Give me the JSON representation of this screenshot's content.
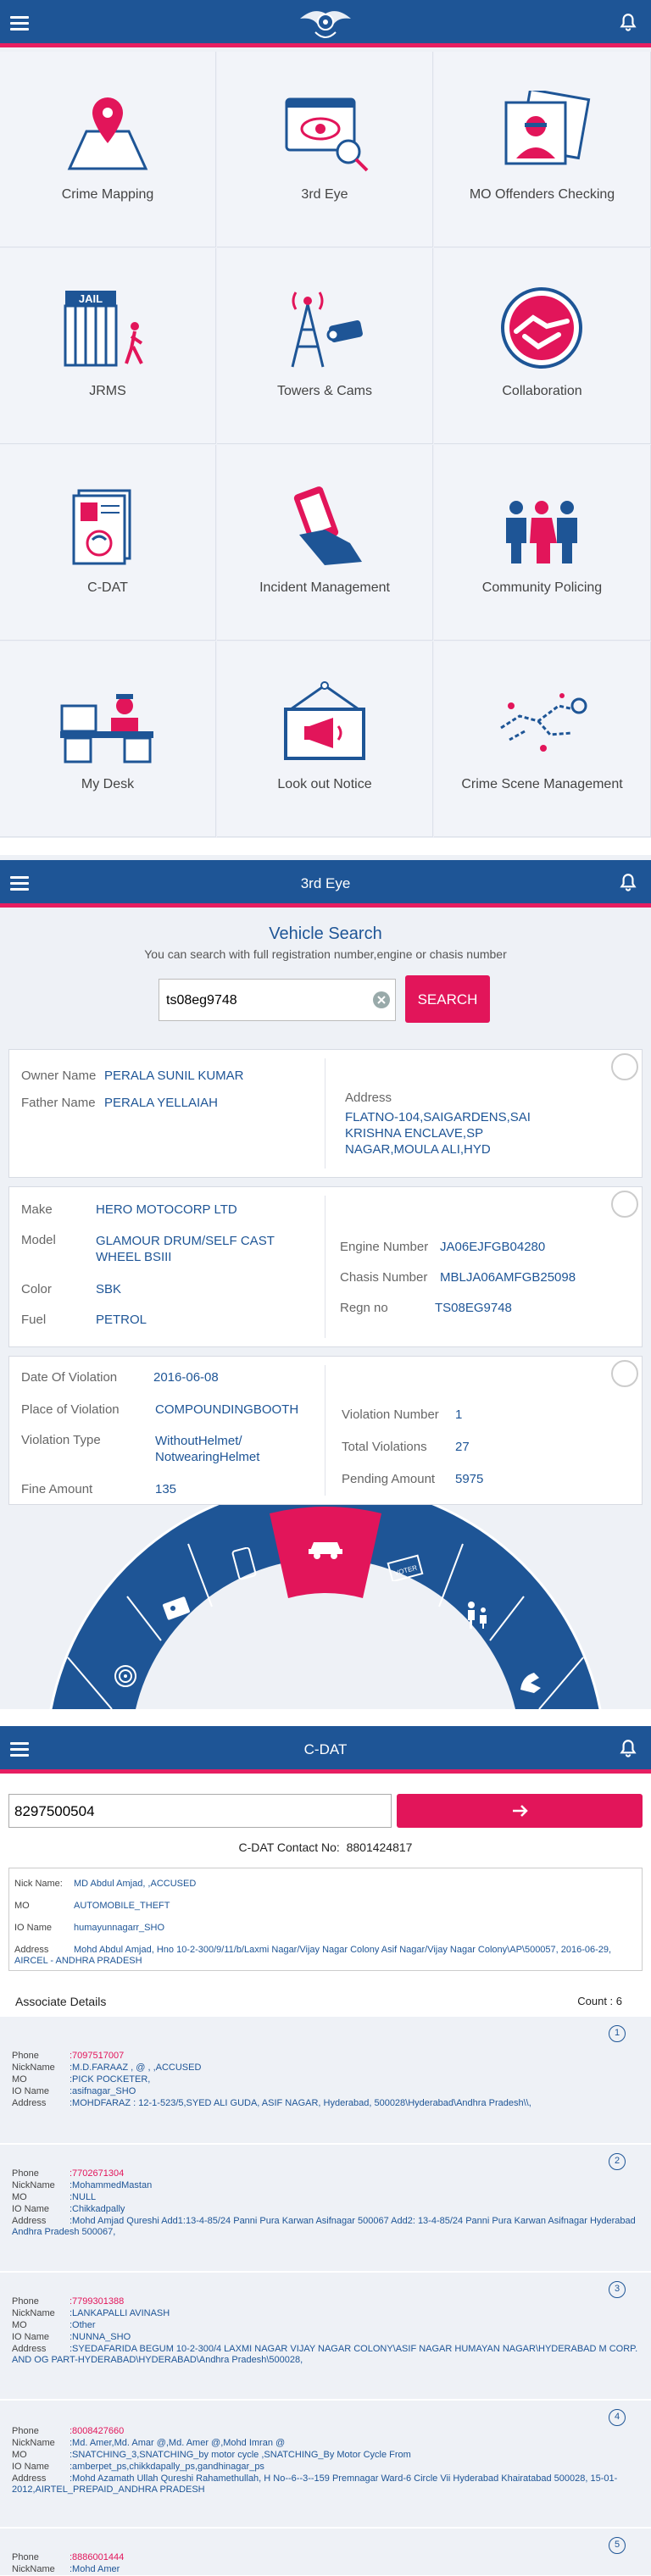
{
  "home": {
    "tiles": [
      {
        "label": "Crime Mapping",
        "icon": "map-pin-icon"
      },
      {
        "label": "3rd Eye",
        "icon": "eye-monitor-icon"
      },
      {
        "label": "MO Offenders Checking",
        "icon": "offender-photo-icon"
      },
      {
        "label": "JRMS",
        "icon": "jail-icon"
      },
      {
        "label": "Towers & Cams",
        "icon": "tower-camera-icon"
      },
      {
        "label": "Collaboration",
        "icon": "handshake-icon"
      },
      {
        "label": "C-DAT",
        "icon": "phone-document-icon"
      },
      {
        "label": "Incident Management",
        "icon": "hand-phone-icon"
      },
      {
        "label": "Community Policing",
        "icon": "people-icon"
      },
      {
        "label": "My Desk",
        "icon": "officer-desk-icon"
      },
      {
        "label": "Look out Notice",
        "icon": "megaphone-board-icon"
      },
      {
        "label": "Crime Scene Management",
        "icon": "body-outline-icon"
      }
    ]
  },
  "vehicle": {
    "appbar_title": "3rd Eye",
    "title": "Vehicle Search",
    "subtitle": "You can search with full registration number,engine or chasis number",
    "search_value": "ts08eg9748",
    "search_button": "SEARCH",
    "owner": {
      "owner_label": "Owner Name",
      "owner_value": "PERALA SUNIL KUMAR",
      "father_label": "Father Name",
      "father_value": "PERALA YELLAIAH",
      "address_label": "Address",
      "address_value": "FLATNO-104,SAIGARDENS,SAI KRISHNA ENCLAVE,SP NAGAR,MOULA ALI,HYD"
    },
    "details": {
      "make_label": "Make",
      "make_value": "HERO MOTOCORP LTD",
      "model_label": "Model",
      "model_value": "GLAMOUR DRUM/SELF CAST WHEEL BSIII",
      "color_label": "Color",
      "color_value": "SBK",
      "fuel_label": "Fuel",
      "fuel_value": "PETROL",
      "engine_label": "Engine Number",
      "engine_value": "JA06EJFGB04280",
      "chasis_label": "Chasis Number",
      "chasis_value": "MBLJA06AMFGB25098",
      "regn_label": "Regn no",
      "regn_value": "TS08EG9748"
    },
    "violation": {
      "date_label": "Date Of Violation",
      "date_value": "2016-06-08",
      "place_label": "Place of Violation",
      "place_value": "COMPOUNDINGBOOTH",
      "type_label": "Violation Type",
      "type_value": "WithoutHelmet/ NotwearingHelmet",
      "fine_label": "Fine Amount",
      "fine_value": "135",
      "vnum_label": "Violation Number",
      "vnum_value": "1",
      "total_label": "Total Violations",
      "total_value": "27",
      "pending_label": "Pending Amount",
      "pending_value": "5975"
    },
    "dial_icons": [
      "fingerprint-icon",
      "id-card-icon",
      "mobile-icon",
      "car-icon",
      "voter-icon",
      "family-icon",
      "hand-icon"
    ]
  },
  "cdat": {
    "appbar_title": "C-DAT",
    "search_value": "8297500504",
    "contact_label": "C-DAT Contact No:",
    "contact_value": "8801424817",
    "accused": {
      "nick_label": "Nick Name:",
      "nick_value": "MD Abdul Amjad, ,ACCUSED",
      "mo_label": "MO",
      "mo_value": "AUTOMOBILE_THEFT",
      "io_label": "IO Name",
      "io_value": "humayunnagarr_SHO",
      "address_label": "Address",
      "address_value": "Mohd  Abdul Amjad, Hno 10-2-300/9/11/b/Laxmi Nagar/Vijay Nagar Colony Asif Nagar/Vijay Nagar Colony\\AP\\500057, 2016-06-29, AIRCEL - ANDHRA PRADESH"
    },
    "assoc_title": "Associate Details",
    "assoc_count": "Count : 6",
    "labels": {
      "phone": "Phone",
      "nick": "NickName",
      "mo": "MO",
      "io": "IO Name",
      "address": "Address"
    },
    "associates": [
      {
        "num": "1",
        "phone": ":7097517007",
        "nick": ":M.D.FARAAZ , @ , ,ACCUSED",
        "mo": ":PICK POCKETER,",
        "io": ":asifnagar_SHO",
        "address": ":MOHDFARAZ : 12-1-523/5,SYED ALI GUDA, ASIF NAGAR, Hyderabad, 500028\\Hyderabad\\Andhra Pradesh\\\\,"
      },
      {
        "num": "2",
        "phone": ":7702671304",
        "nick": ":MohammedMastan",
        "mo": ":NULL",
        "io": ":Chikkadpally",
        "address": ":Mohd Amjad Qureshi Add1:13-4-85/24 Panni Pura Karwan Asifnagar 500067 Add2: 13-4-85/24 Panni Pura Karwan Asifnagar Hyderabad Andhra Pradesh 500067,"
      },
      {
        "num": "3",
        "phone": ":7799301388",
        "nick": ":LANKAPALLI AVINASH",
        "mo": ":Other",
        "io": ":NUNNA_SHO",
        "address": ":SYEDAFARIDA BEGUM 10-2-300/4 LAXMI NAGAR VIJAY NAGAR COLONY\\ASIF NAGAR HUMAYAN NAGAR\\HYDERABAD M CORP. AND OG PART-HYDERABAD\\HYDERABAD\\Andhra Pradesh\\500028,"
      },
      {
        "num": "4",
        "phone": ":8008427660",
        "nick": ":Md. Amer,Md. Amar @,Md. Amer @,Mohd Imran @",
        "mo": ":SNATCHING_3,SNATCHING_by motor cycle ,SNATCHING_By Motor Cycle From",
        "io": ":amberpet_ps,chikkdapally_ps,gandhinagar_ps",
        "address": ":Mohd Azamath Ullah Qureshi Rahamethullah, H No--6--3--159 Premnagar Ward-6 Circle Vii Hyderabad Khairatabad 500028, 15-01-2012,AIRTEL_PREPAID_ANDHRA PRADESH"
      },
      {
        "num": "5",
        "phone": ":8886001444",
        "nick": ":Mohd Amer"
      }
    ]
  }
}
